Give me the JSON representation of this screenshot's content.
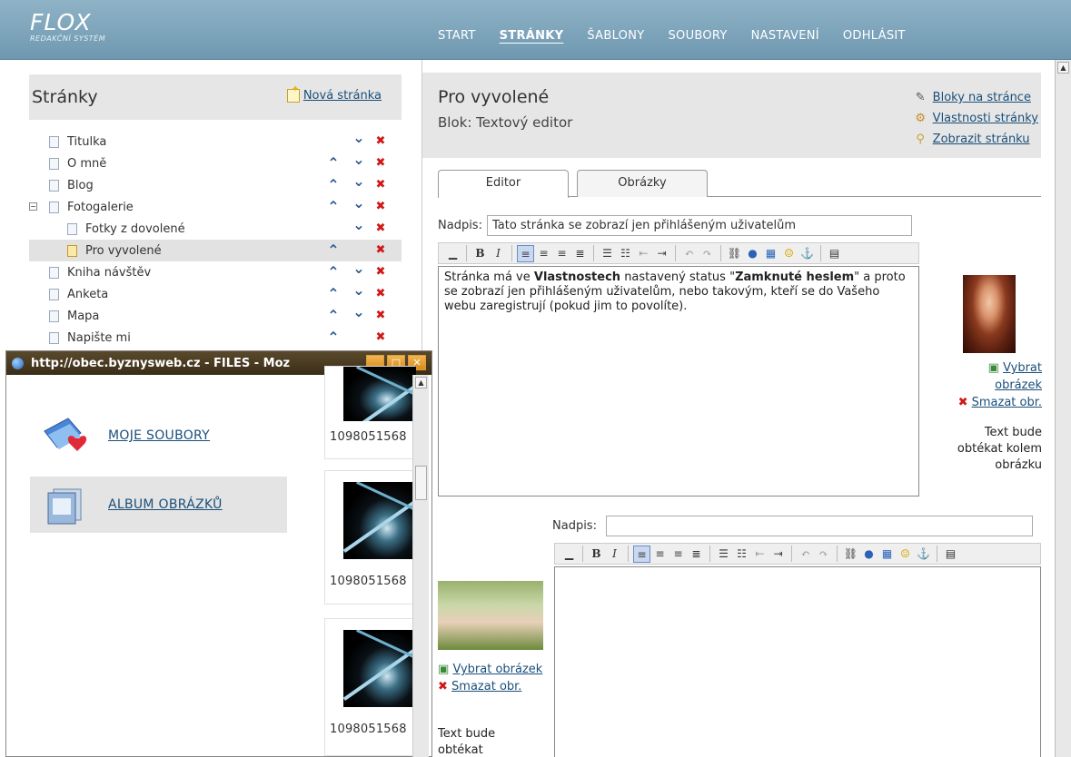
{
  "header": {
    "logo_name": "FLOX",
    "logo_sub": "REDAKČNÍ SYSTÉM",
    "nav": [
      "START",
      "STRÁNKY",
      "ŠABLONY",
      "SOUBORY",
      "NASTAVENÍ",
      "ODHLÁSIT"
    ],
    "active_nav": "STRÁNKY"
  },
  "left": {
    "title": "Stránky",
    "new_page": "Nová stránka",
    "tree": [
      {
        "label": "Titulka",
        "up": false,
        "down": true
      },
      {
        "label": "O mně",
        "up": true,
        "down": true
      },
      {
        "label": "Blog",
        "up": true,
        "down": true
      },
      {
        "label": "Fotogalerie",
        "up": true,
        "down": true,
        "toggle": "⊟"
      },
      {
        "label": "Fotky z dovolené",
        "up": false,
        "down": true,
        "child": true
      },
      {
        "label": "Pro vyvolené",
        "up": true,
        "down": false,
        "child": true,
        "selected": true,
        "locked": true
      },
      {
        "label": "Kniha návštěv",
        "up": true,
        "down": true
      },
      {
        "label": "Anketa",
        "up": true,
        "down": true
      },
      {
        "label": "Mapa",
        "up": true,
        "down": true
      },
      {
        "label": "Napište mi",
        "up": true,
        "down": false
      }
    ]
  },
  "popup": {
    "title": "http://obec.byznysweb.cz - FILES - Moz",
    "menu": [
      "MOJE SOUBORY",
      "ALBUM OBRÁZKŮ"
    ],
    "thumbs": [
      "1098051568",
      "1098051568",
      "1098051568"
    ]
  },
  "main": {
    "page_name": "Pro vyvolené",
    "block_name": "Blok: Textový editor",
    "links": [
      "Bloky na stránce",
      "Vlastnosti stránky",
      "Zobrazit stránku"
    ],
    "tabs": [
      "Editor",
      "Obrázky"
    ],
    "editor1": {
      "label": "Nadpis:",
      "value": "Tato stránka se zobrazí jen přihlášeným uživatelům",
      "content_parts": [
        "Stránka má ve ",
        "Vlastnostech",
        " nastavený status \"",
        "Zamknuté heslem",
        "\" a proto se zobrazí jen přihlášeným uživatelům, nebo takovým, kteří se do Vašeho webu zaregistrují (pokud jim to povolíte)."
      ],
      "select_image": "Vybrat obrázek",
      "delete_image": "Smazat obr.",
      "wrap_text": "Text bude obtékat kolem obrázku"
    },
    "editor2": {
      "label": "Nadpis:",
      "value": "",
      "select_image": "Vybrat obrázek",
      "delete_image": "Smazat obr.",
      "wrap_text": "Text bude obtékat kolem"
    }
  },
  "colors": {
    "header": "#7aa2b8",
    "link": "#1a4f7a",
    "delete": "#d01818"
  }
}
